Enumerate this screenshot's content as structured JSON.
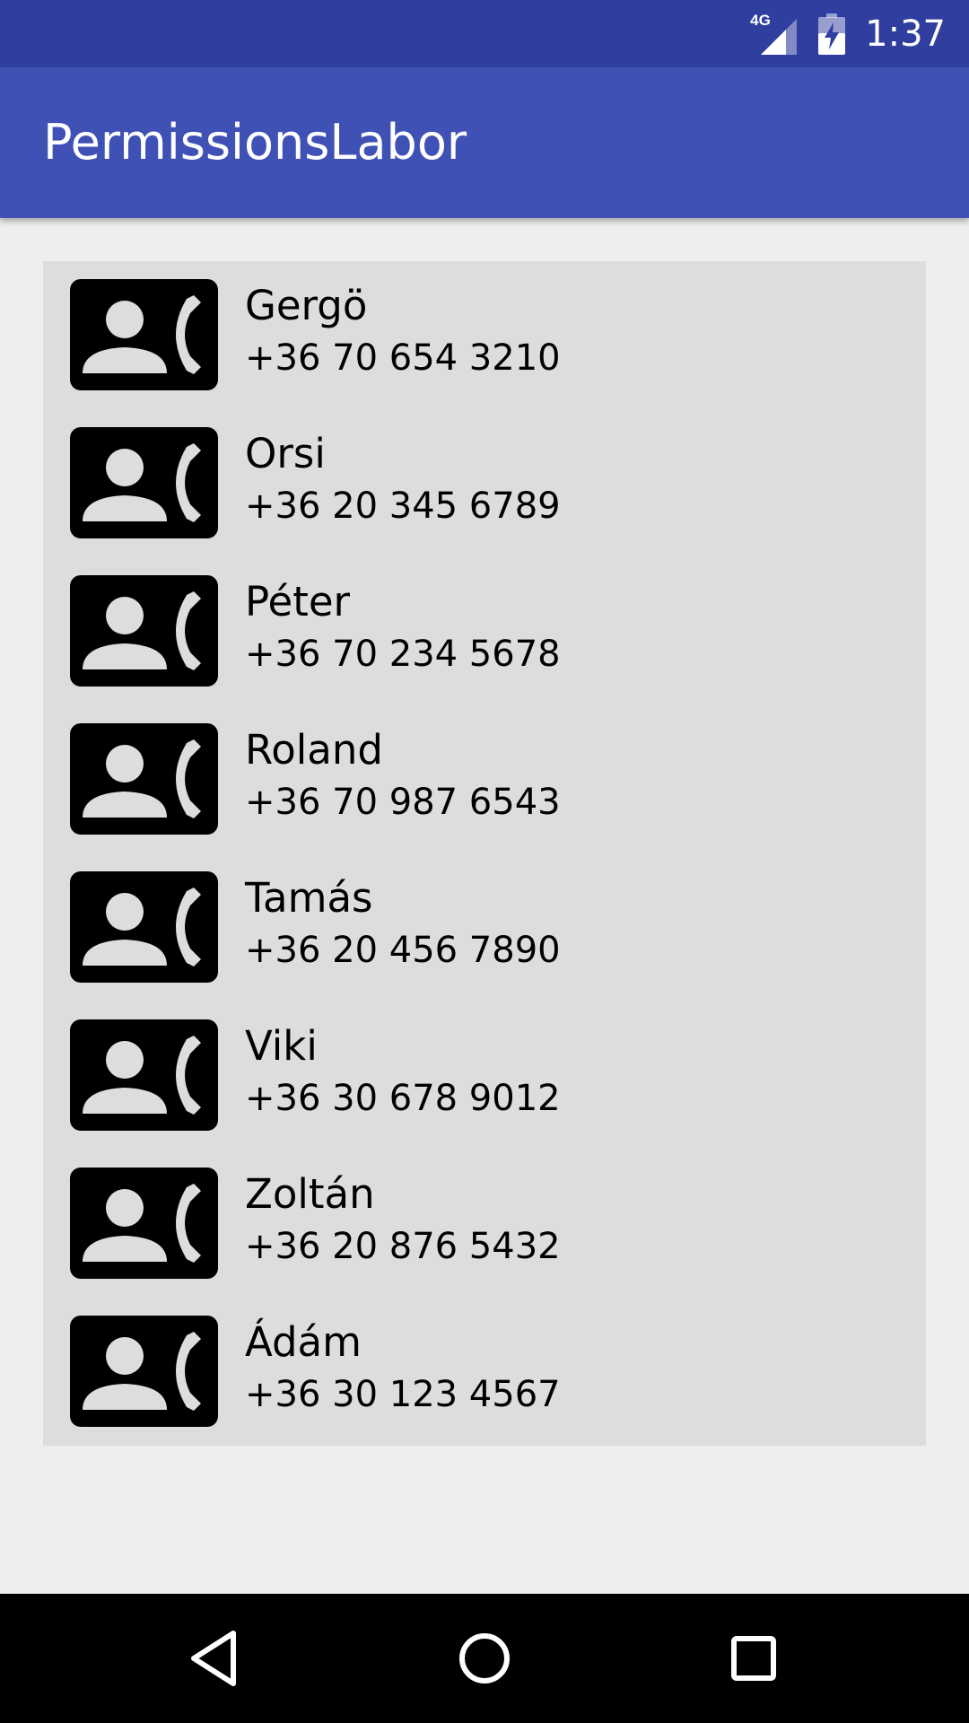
{
  "status_bar": {
    "network_type": "4G",
    "signal_icon": "cell-signal-icon",
    "battery_icon": "battery-charging-icon",
    "time": "1:37",
    "background_color": "#303f9f"
  },
  "app_bar": {
    "title": "PermissionsLabor",
    "background_color": "#3f51b5"
  },
  "contacts": [
    {
      "name": "Gergö",
      "phone": "+36 70 654 3210",
      "icon": "contact-phone-icon"
    },
    {
      "name": "Orsi",
      "phone": "+36 20 345 6789",
      "icon": "contact-phone-icon"
    },
    {
      "name": "Péter",
      "phone": "+36 70 234 5678",
      "icon": "contact-phone-icon"
    },
    {
      "name": "Roland",
      "phone": "+36 70 987 6543",
      "icon": "contact-phone-icon"
    },
    {
      "name": "Tamás",
      "phone": "+36 20 456 7890",
      "icon": "contact-phone-icon"
    },
    {
      "name": "Viki",
      "phone": "+36 30 678 9012",
      "icon": "contact-phone-icon"
    },
    {
      "name": "Zoltán",
      "phone": "+36 20 876 5432",
      "icon": "contact-phone-icon"
    },
    {
      "name": "Ádám",
      "phone": "+36 30 123 4567",
      "icon": "contact-phone-icon"
    }
  ],
  "nav_bar": {
    "back_icon": "back-triangle-icon",
    "home_icon": "home-circle-icon",
    "recents_icon": "recents-square-icon"
  }
}
